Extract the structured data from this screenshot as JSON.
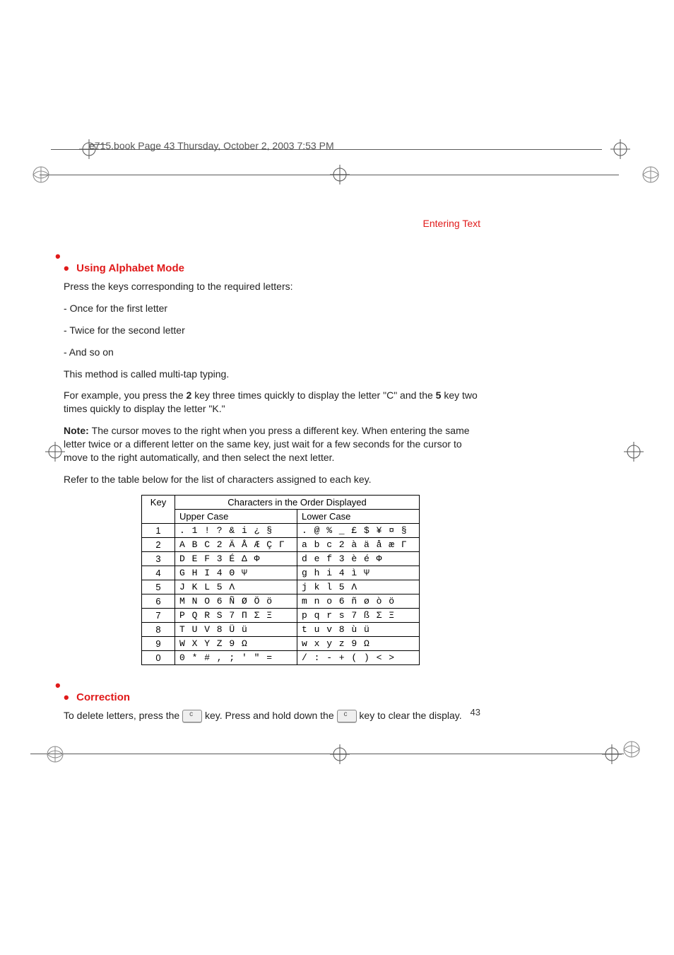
{
  "book_header": "e715.book  Page 43  Thursday, October 2, 2003  7:53 PM",
  "running_title": "Entering Text",
  "section1": {
    "bullets_prefix": "",
    "title": "Using Alphabet Mode",
    "para1": "Press the keys corresponding to the required letters:",
    "li1": "Once for the first letter",
    "li2": "Twice for the second letter",
    "li3": "And so on",
    "para2": "This method is called multi-tap typing.",
    "example_lead": "For example, you press the ",
    "example_key1": "2",
    "example_mid1": " key three times quickly to display the letter \"C\" and the ",
    "example_key2": "5",
    "example_mid2": " key two times quickly to display the letter \"K.\"",
    "note_label": "Note: ",
    "note_text": "The cursor moves to the right when you press a different key. When entering the same letter twice or a different letter on the same key, just wait for a few seconds for the cursor to move to the right automatically, and then select the next letter.",
    "table_intro": "Refer to the table below for the list of characters assigned to each key."
  },
  "char_table": {
    "header_span": "Characters in the Order Displayed",
    "key_label": "Key",
    "upper_label": "Upper Case",
    "lower_label": "Lower Case",
    "rows": [
      {
        "k": "1",
        "u": ". 1 ! ? & i ¿ §",
        "l": ". @ % _ £ $ ¥ ¤ §"
      },
      {
        "k": "2",
        "u": "A B C 2 Ä Å Æ Ç Γ",
        "l": "a b c 2 à ä å æ Γ"
      },
      {
        "k": "3",
        "u": "D E F 3 É Δ Φ",
        "l": "d e f 3 è é Φ"
      },
      {
        "k": "4",
        "u": "G H I 4 Θ Ψ",
        "l": "g h i 4 ì Ψ"
      },
      {
        "k": "5",
        "u": "J K L 5 Λ",
        "l": "j k l 5 Λ"
      },
      {
        "k": "6",
        "u": "M N O 6 Ñ Ø Ö ö",
        "l": "m n o 6 ñ ø ò ö"
      },
      {
        "k": "7",
        "u": "P Q R S 7 Π Σ Ξ",
        "l": "p q r s 7 ß Σ Ξ"
      },
      {
        "k": "8",
        "u": "T U V 8 Ü ü",
        "l": "t u v 8 ù ü"
      },
      {
        "k": "9",
        "u": "W X Y Z 9 Ω",
        "l": "w x y z 9 Ω"
      },
      {
        "k": "0",
        "u": "0 * # , ; ' \" =",
        "l": "/ : - + ( ) < >"
      }
    ]
  },
  "section2": {
    "title": "Correction",
    "para_a": "To delete letters, press the ",
    "para_b": " key. Press and hold down the ",
    "para_c": " key to clear the display."
  },
  "page_number": "43",
  "chart_data": {
    "type": "table",
    "title": "Characters in the Order Displayed",
    "columns": [
      "Key",
      "Upper Case",
      "Lower Case"
    ],
    "rows": [
      [
        "1",
        ". 1 ! ? & i ¿ §",
        ". @ % _ £ $ ¥ ¤ §"
      ],
      [
        "2",
        "A B C 2 Ä Å Æ Ç Γ",
        "a b c 2 à ä å æ Γ"
      ],
      [
        "3",
        "D E F 3 É Δ Φ",
        "d e f 3 è é Φ"
      ],
      [
        "4",
        "G H I 4 Θ Ψ",
        "g h i 4 ì Ψ"
      ],
      [
        "5",
        "J K L 5 Λ",
        "j k l 5 Λ"
      ],
      [
        "6",
        "M N O 6 Ñ Ø Ö ö",
        "m n o 6 ñ ø ò ö"
      ],
      [
        "7",
        "P Q R S 7 Π Σ Ξ",
        "p q r s 7 ß Σ Ξ"
      ],
      [
        "8",
        "T U V 8 Ü ü",
        "t u v 8 ù ü"
      ],
      [
        "9",
        "W X Y Z 9 Ω",
        "w x y z 9 Ω"
      ],
      [
        "0",
        "0 * # , ; ' \" =",
        "/ : - + ( ) < >"
      ]
    ]
  }
}
